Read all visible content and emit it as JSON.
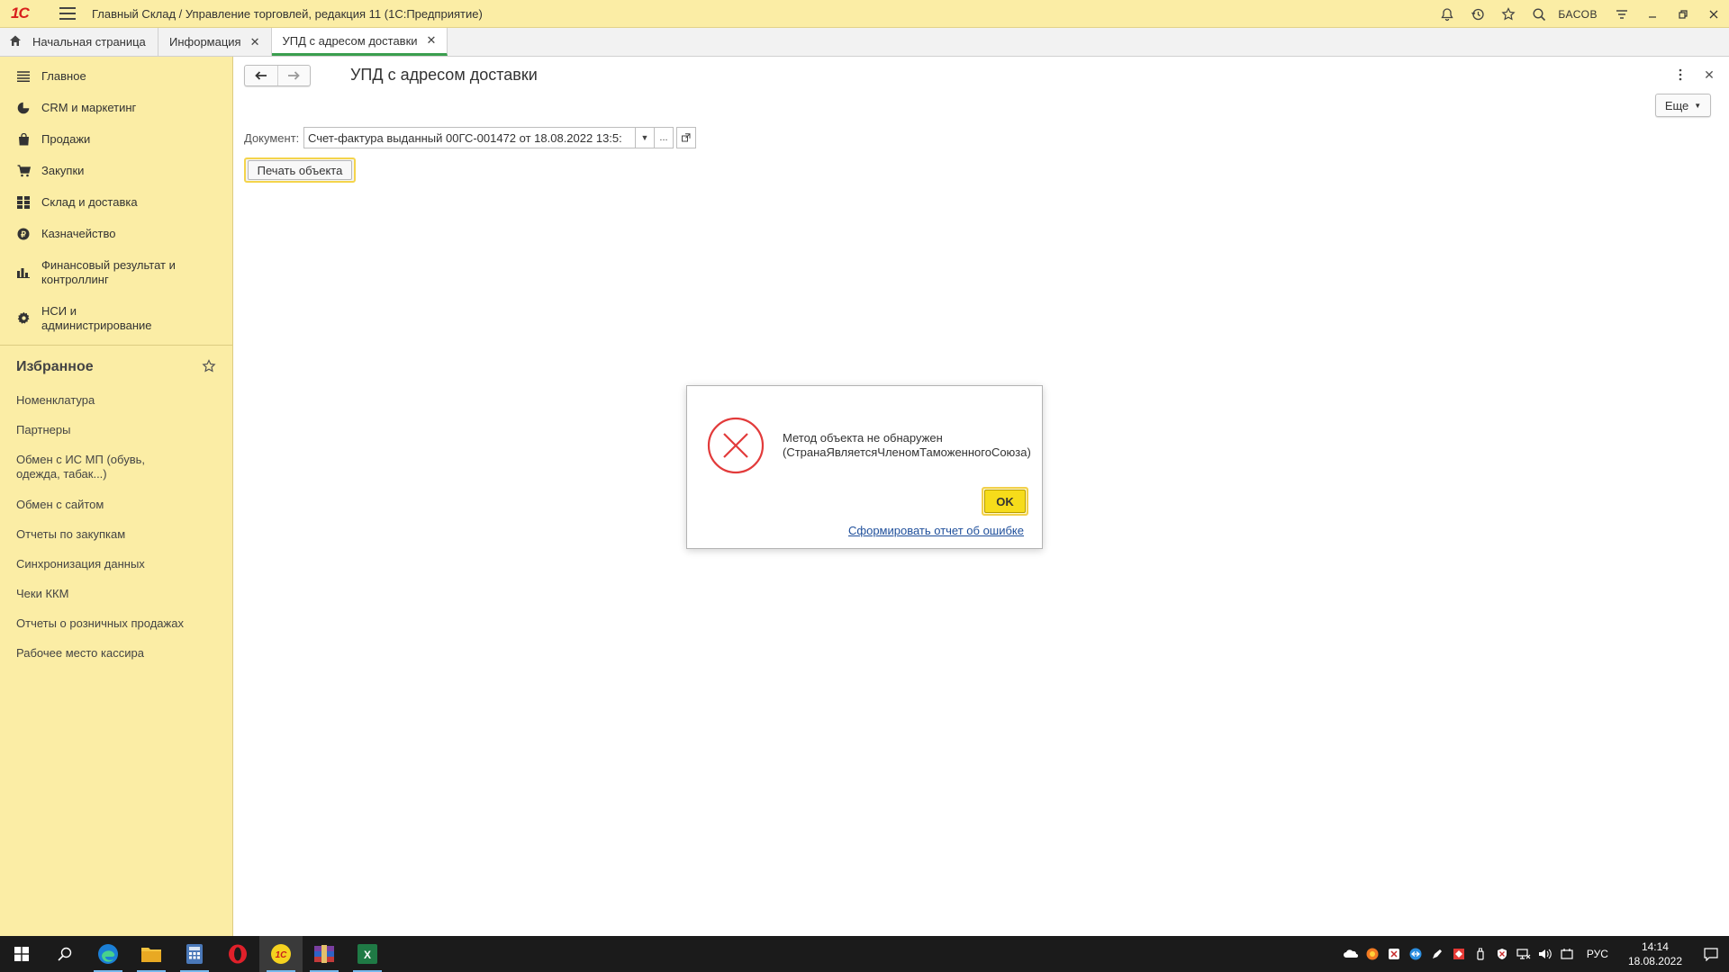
{
  "titlebar": {
    "logo": "1С",
    "title": "Главный Склад / Управление торговлей, редакция 11  (1С:Предприятие)",
    "user": "БАСОВ"
  },
  "tabs": [
    {
      "label": "Начальная страница"
    },
    {
      "label": "Информация"
    },
    {
      "label": "УПД с адресом доставки"
    }
  ],
  "sidebar": {
    "sections": [
      {
        "label": "Главное",
        "icon": "menu-icon"
      },
      {
        "label": "CRM и маркетинг",
        "icon": "pie-chart-icon"
      },
      {
        "label": "Продажи",
        "icon": "shopping-bag-icon"
      },
      {
        "label": "Закупки",
        "icon": "cart-icon"
      },
      {
        "label": "Склад и доставка",
        "icon": "grid-icon"
      },
      {
        "label": "Казначейство",
        "icon": "ruble-coin-icon"
      },
      {
        "label": "Финансовый результат и контроллинг",
        "icon": "bar-chart-icon"
      },
      {
        "label": "НСИ и администрирование",
        "icon": "gear-icon"
      }
    ],
    "favorites_title": "Избранное",
    "favorites": [
      "Номенклатура",
      "Партнеры",
      "Обмен с ИС МП (обувь, одежда, табак...)",
      "Обмен с сайтом",
      "Отчеты по закупкам",
      "Синхронизация данных",
      "Чеки ККМ",
      "Отчеты о розничных продажах",
      "Рабочее место кассира"
    ]
  },
  "main": {
    "title": "УПД с адресом доставки",
    "more_label": "Еще",
    "document_label": "Документ:",
    "document_value": "Счет-фактура выданный 00ГС-001472 от 18.08.2022 13:5:",
    "select_btn": "...",
    "print_label": "Печать объекта"
  },
  "dialog": {
    "message_line1": "Метод объекта не обнаружен",
    "message_line2": "(СтранаЯвляетсяЧленомТаможенногоСоюза)",
    "ok_label": "OK",
    "report_link": "Сформировать отчет об ошибке"
  },
  "taskbar": {
    "lang": "РУС",
    "time": "14:14",
    "date": "18.08.2022"
  },
  "colors": {
    "accent_yellow": "#fbeda5",
    "active_tab": "#3a9e4e",
    "error_red": "#e23b3b",
    "ok_yellow": "#f6dc1a"
  }
}
